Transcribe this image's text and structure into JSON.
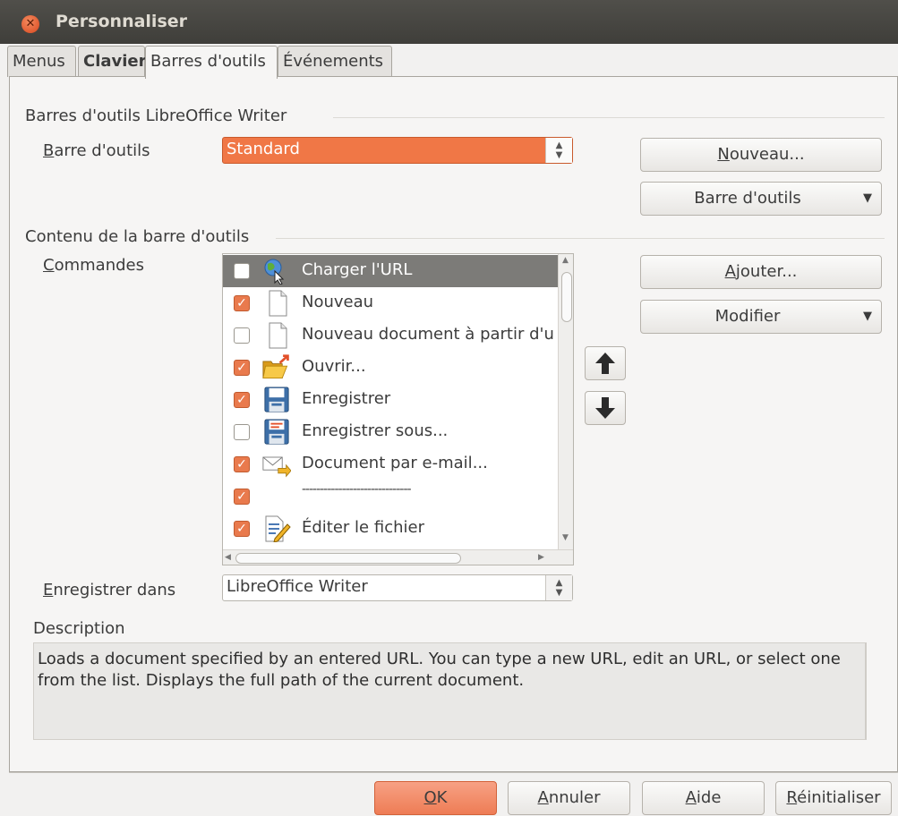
{
  "window": {
    "title": "Personnaliser"
  },
  "tabs": [
    {
      "label": "Menus"
    },
    {
      "label": "Clavier"
    },
    {
      "label": "Barres d'outils"
    },
    {
      "label": "Événements"
    }
  ],
  "toolbars_section": {
    "heading": "Barres d'outils LibreOffice Writer",
    "toolbar_label_key": "B",
    "toolbar_label_rest": "arre d'outils",
    "toolbar_value": "Standard",
    "new_button_key": "N",
    "new_button_rest": "ouveau...",
    "toolbar_menu_button": "Barre d'outils"
  },
  "content_section": {
    "heading": "Contenu de la barre d'outils",
    "commands_label_key": "C",
    "commands_label_rest": "ommandes",
    "add_button_key": "A",
    "add_button_rest": "jouter...",
    "modify_button": "Modifier",
    "commands": [
      {
        "label": "Charger l'URL",
        "checked": false,
        "selected": true,
        "icon": "globe-icon"
      },
      {
        "label": "Nouveau",
        "checked": true,
        "selected": false,
        "icon": "document-icon"
      },
      {
        "label": "Nouveau document à partir d'u",
        "checked": false,
        "selected": false,
        "icon": "document-icon"
      },
      {
        "label": "Ouvrir...",
        "checked": true,
        "selected": false,
        "icon": "folder-open-icon"
      },
      {
        "label": "Enregistrer",
        "checked": true,
        "selected": false,
        "icon": "floppy-icon"
      },
      {
        "label": "Enregistrer sous...",
        "checked": false,
        "selected": false,
        "icon": "floppy-save-as-icon"
      },
      {
        "label": "Document par e-mail...",
        "checked": true,
        "selected": false,
        "icon": "email-icon"
      },
      {
        "label": "------------------------------",
        "checked": true,
        "selected": false,
        "icon": ""
      },
      {
        "label": "Éditer le fichier",
        "checked": true,
        "selected": false,
        "icon": "edit-file-icon"
      }
    ],
    "save_in_label_key": "E",
    "save_in_label_rest": "nregistrer dans",
    "save_in_value": "LibreOffice Writer"
  },
  "description": {
    "heading": "Description",
    "text": "Loads a document specified by an entered URL. You can type a new URL, edit an URL, or select one from the list. Displays the full path of the current document."
  },
  "footer": {
    "ok_key": "O",
    "ok_rest": "K",
    "cancel_key": "A",
    "cancel_rest": "nnuler",
    "help_key": "A",
    "help_rest": "ide",
    "reset_key": "R",
    "reset_rest": "éinitialiser"
  },
  "colors": {
    "accent": "#f07746",
    "selection_row": "#7c7b78",
    "titlebar": "#3f3e3a"
  }
}
